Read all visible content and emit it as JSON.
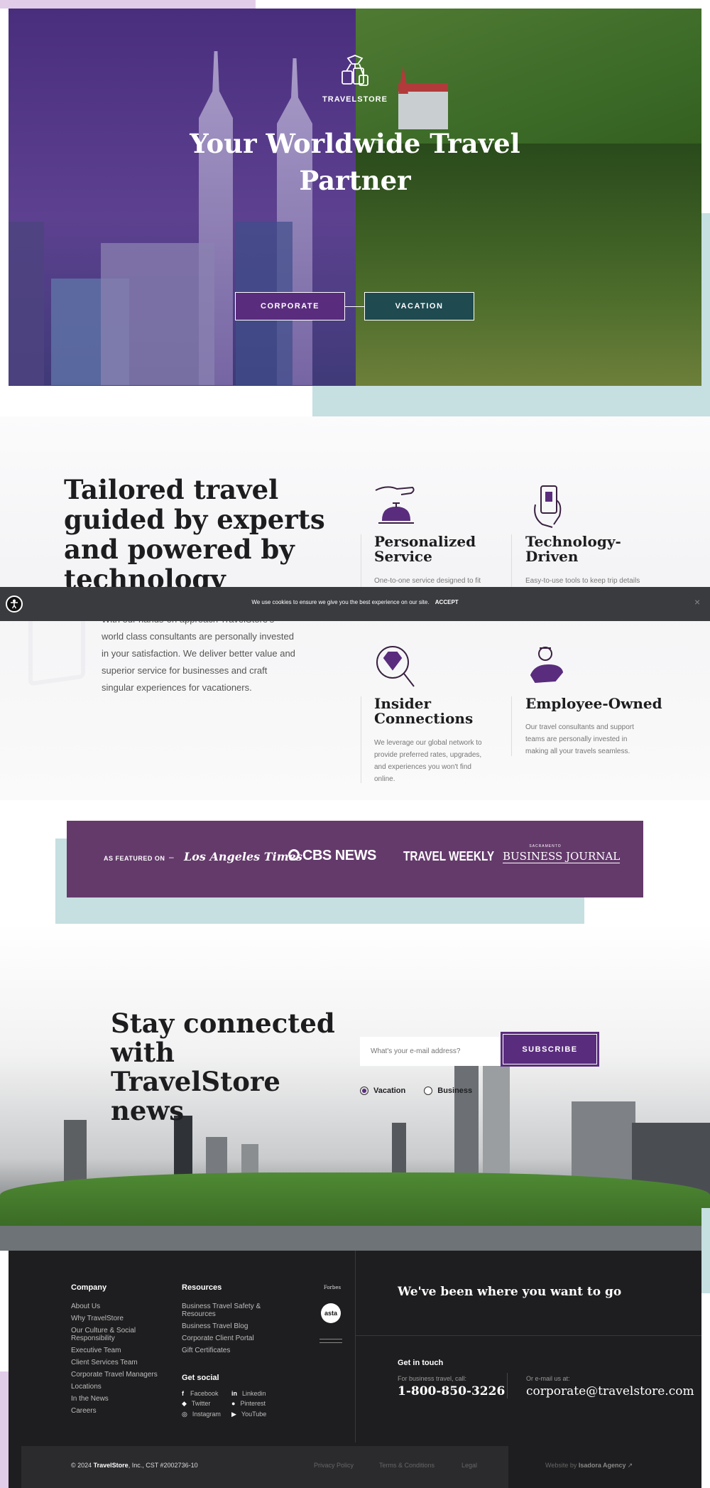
{
  "hero": {
    "brand": "TRAVELSTORE",
    "title_line1": "Your Worldwide Travel",
    "title_line2": "Partner",
    "corporate_label": "CORPORATE",
    "vacation_label": "VACATION"
  },
  "intro": {
    "heading_lines": [
      "Tailored travel",
      "guided by experts",
      "and powered by",
      "technology"
    ],
    "body_lines": [
      "With our hands-on approach TravelStore's",
      "world class consultants are personally invested",
      "in your satisfaction.  We deliver better value and",
      "superior service for businesses and craft",
      "singular experiences for vacationers."
    ]
  },
  "features": [
    {
      "icon": "concierge-bell-icon",
      "title_lines": [
        "Personalized",
        "Service"
      ],
      "text_lines": [
        "One-to-one service designed to fit"
      ]
    },
    {
      "icon": "phone-hand-icon",
      "title_lines": [
        "Technology-",
        "Driven"
      ],
      "text_lines": [
        "Easy-to-use tools to keep trip details"
      ]
    },
    {
      "icon": "diamond-magnifier-icon",
      "title_lines": [
        "Insider",
        "Connections"
      ],
      "text_lines": [
        "We leverage our global network to",
        "provide preferred rates, upgrades,",
        "and experiences you won't find",
        "online."
      ]
    },
    {
      "icon": "employee-icon",
      "title_lines": [
        "Employee-Owned"
      ],
      "text_lines": [
        "Our travel consultants and support",
        "teams are personally invested in",
        "making all your travels seamless."
      ]
    }
  ],
  "cookie": {
    "message": "We use cookies to ensure we give you the best experience on our site.",
    "accept": "ACCEPT",
    "close": "×"
  },
  "featured": {
    "label": "AS FEATURED ON",
    "dash": "–",
    "logos": [
      "Los Angeles Times",
      "CBS NEWS",
      "TRAVEL WEEKLY",
      "BUSINESS JOURNAL"
    ],
    "logo_small": "SACRAMENTO"
  },
  "newsletter": {
    "heading_lines": [
      "Stay connected",
      "with TravelStore",
      "news"
    ],
    "email_placeholder": "What's your e-mail address?",
    "subscribe": "SUBSCRIBE",
    "options": [
      "Vacation",
      "Business"
    ],
    "selected": "Vacation"
  },
  "footer": {
    "company_head": "Company",
    "company_links": [
      "About Us",
      "Why TravelStore",
      "Our Culture & Social",
      "Responsibility",
      "Executive Team",
      "Client Services Team",
      "Corporate Travel Managers",
      "Locations",
      "In the News",
      "Careers"
    ],
    "resources_head": "Resources",
    "resources_links": [
      "Business Travel Safety &",
      "Resources",
      "Business Travel Blog",
      "Corporate Client Portal",
      "Gift Certificates"
    ],
    "social_head": "Get social",
    "social": [
      "Facebook",
      "Linkedin",
      "Twitter",
      "Pinterest",
      "Instagram",
      "YouTube"
    ],
    "badges": [
      "Forbes",
      "asta"
    ],
    "tagline": "We've been where you want to go",
    "touch_head": "Get in touch",
    "call_label": "For business travel, call:",
    "phone": "1-800-850-3226",
    "email_label": "Or e-mail us at:",
    "email": "corporate@travelstore.com",
    "copyright_pre": "© 2024 ",
    "copyright_brand": "TravelStore",
    "copyright_post": ", Inc., CST #2002736-10",
    "legal_links": [
      "Privacy Policy",
      "Terms & Conditions",
      "Legal"
    ],
    "credit_pre": "Website by ",
    "credit_agency": "Isadora Agency"
  }
}
